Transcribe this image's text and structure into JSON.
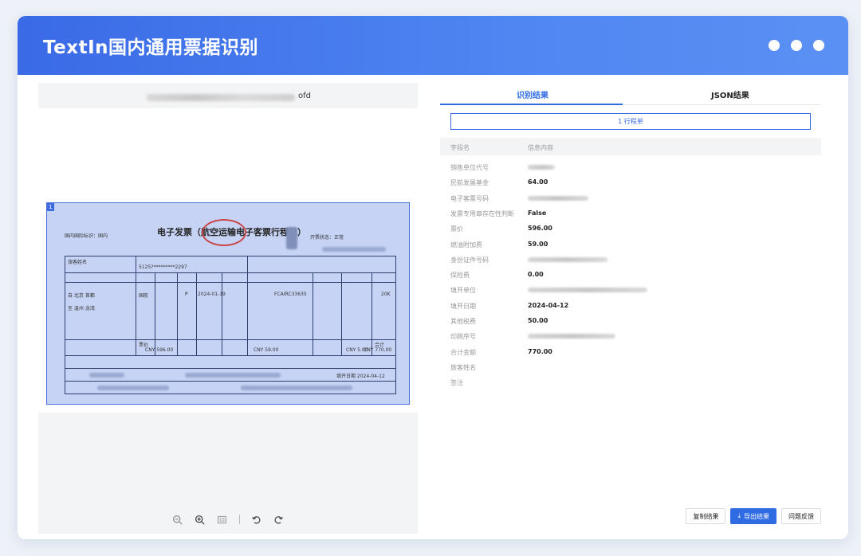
{
  "app": {
    "title": "TextIn国内通用票据识别",
    "accent_color": "#3a6ae6",
    "window_controls": [
      "dot",
      "dot",
      "dot"
    ]
  },
  "document": {
    "file_extension": "ofd",
    "region_index": "1",
    "invoice_title": "电子发票（航空运输电子客票行程单）",
    "invoice_labels": {
      "domestic": "国内国际标识：国内",
      "passenger": "旅客姓名",
      "status": "开票状态：正常",
      "from_line": "自 北京 首都",
      "to_line": "至 温州 龙湾",
      "fare": "票价",
      "fare_value": "CNY 596.00",
      "fuel_value": "CNY 59.00",
      "fund_value": "CNY 5.00",
      "total": "合计",
      "total_value": "CNY 770.00",
      "date_value": "2024-01-19",
      "issue_date": "填开日期 2024-04-12",
      "carrier": "国航",
      "class": "P",
      "id_number": "5125?*********2297",
      "fare_basis": "FCAIRC33635",
      "luggage": "20K"
    },
    "toolbar": [
      "zoom-out-icon",
      "zoom-in-icon",
      "fit-icon",
      "rotate-left-icon",
      "rotate-right-icon"
    ]
  },
  "results": {
    "tabs": [
      {
        "label": "识别结果",
        "active": true
      },
      {
        "label": "JSON结果",
        "active": false
      }
    ],
    "document_type": "1 行程单",
    "columns": {
      "field": "字段名",
      "info": "信息内容"
    },
    "rows": [
      {
        "key": "销售单位代号",
        "value": "",
        "redacted": true
      },
      {
        "key": "民航发展基金",
        "value": "64.00"
      },
      {
        "key": "电子客票号码",
        "value": "",
        "redacted": true
      },
      {
        "key": "发票专用章存在性判断",
        "value": "False"
      },
      {
        "key": "票价",
        "value": "596.00"
      },
      {
        "key": "燃油附加费",
        "value": "59.00"
      },
      {
        "key": "身份证件号码",
        "value": "",
        "redacted": true
      },
      {
        "key": "保险费",
        "value": "0.00"
      },
      {
        "key": "填开单位",
        "value": "",
        "redacted": true
      },
      {
        "key": "填开日期",
        "value": "2024-04-12"
      },
      {
        "key": "其他税费",
        "value": "50.00"
      },
      {
        "key": "印刷序号",
        "value": "",
        "redacted": true
      },
      {
        "key": "合计金额",
        "value": "770.00"
      },
      {
        "key": "旅客姓名",
        "value": ""
      },
      {
        "key": "签注",
        "value": ""
      }
    ],
    "actions": {
      "copy": "复制结果",
      "export": "导出结果",
      "feedback": "问题反馈"
    }
  }
}
